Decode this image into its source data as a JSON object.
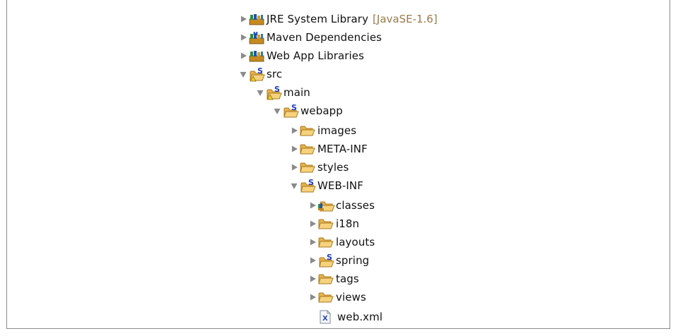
{
  "tree": {
    "jre": {
      "label": "JRE System Library",
      "decoration": "[JavaSE-1.6]",
      "icon": "library-icon"
    },
    "maven": {
      "label": "Maven Dependencies",
      "icon": "maven-library-icon"
    },
    "webapplib": {
      "label": "Web App Libraries",
      "icon": "library-icon"
    },
    "src": {
      "label": "src",
      "icon": "spring-folder-warning-icon"
    },
    "main": {
      "label": "main",
      "icon": "spring-folder-warning-icon"
    },
    "webapp": {
      "label": "webapp",
      "icon": "spring-folder-icon"
    },
    "images": {
      "label": "images",
      "icon": "folder-icon"
    },
    "metainf": {
      "label": "META-INF",
      "icon": "folder-icon"
    },
    "styles": {
      "label": "styles",
      "icon": "folder-icon"
    },
    "webinf": {
      "label": "WEB-INF",
      "icon": "spring-folder-icon"
    },
    "classes": {
      "label": "classes",
      "icon": "classes-folder-icon"
    },
    "i18n": {
      "label": "i18n",
      "icon": "folder-icon"
    },
    "layouts": {
      "label": "layouts",
      "icon": "folder-icon"
    },
    "spring": {
      "label": "spring",
      "icon": "spring-folder-icon"
    },
    "tags": {
      "label": "tags",
      "icon": "folder-icon"
    },
    "views": {
      "label": "views",
      "icon": "folder-icon"
    },
    "webxml": {
      "label": "web.xml",
      "icon": "xml-file-icon"
    }
  },
  "colors": {
    "folder": "#f2c76a",
    "folder_edge": "#b88a2a",
    "spring_s": "#1a3cc8",
    "twisty": "#8a8a8a"
  }
}
